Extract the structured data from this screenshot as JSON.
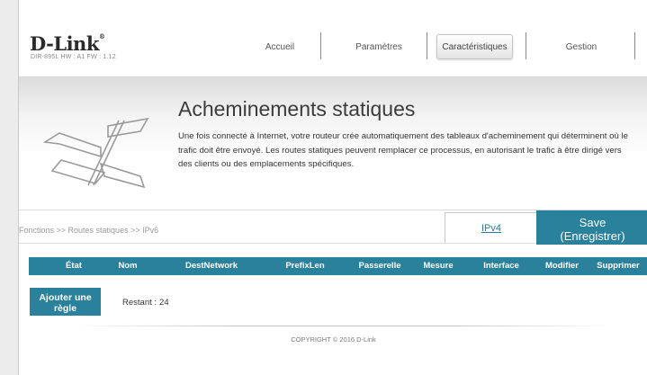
{
  "header": {
    "logo": "D-Link",
    "model_info": "DIR-895L  HW : A1   FW : 1.12",
    "nav": [
      {
        "label": "Accueil",
        "active": false
      },
      {
        "label": "Paramètres",
        "active": false
      },
      {
        "label": "Caractéristiques",
        "active": true
      },
      {
        "label": "Gestion",
        "active": false
      }
    ]
  },
  "banner": {
    "icon": "signpost-icon",
    "title": "Acheminements statiques",
    "description": "Une fois connecté à Internet, votre routeur crée automatiquement des tableaux d'acheminement qui déterminent où le trafic doit être envoyé. Les routes statiques peuvent remplacer ce processus, en autorisant le trafic à être dirigé vers des clients ou des emplacements spécifiques."
  },
  "actionbar": {
    "breadcrumb": "Fonctions >> Routes statiques >> IPv6",
    "ipv4_link": "IPv4",
    "save_line1": "Save",
    "save_line2": "(Enregistrer)"
  },
  "table": {
    "columns": [
      "État",
      "Nom",
      "DestNetwork",
      "PrefixLen",
      "Passerelle",
      "Mesure",
      "Interface",
      "Modifier",
      "Supprimer"
    ],
    "rows": []
  },
  "rules": {
    "add_line1": "Ajouter une",
    "add_line2": "règle",
    "remaining_label": "Restant :",
    "remaining_count": "24"
  },
  "footer": {
    "copyright": "COPYRIGHT © 2016 D-Link"
  },
  "colors": {
    "accent": "#2a819c",
    "link": "#1f7fa0",
    "page_background": "#ececec"
  }
}
